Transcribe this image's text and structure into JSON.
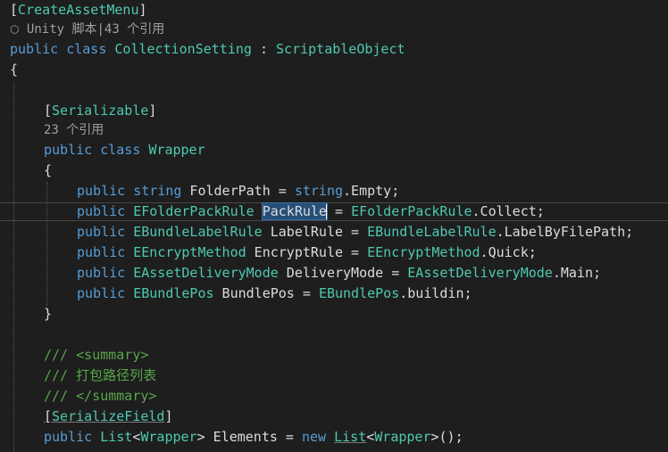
{
  "editor": {
    "lines": {
      "l1": {
        "lb": "[",
        "name": "CreateAssetMenu",
        "rb": "]"
      },
      "l2": {
        "lens": "Unity 脚本|43 个引用"
      },
      "l3": {
        "kw1": "public",
        "kw2": "class",
        "name": "CollectionSetting",
        "colon": " : ",
        "base": "ScriptableObject"
      },
      "l4": {
        "brace": "{"
      },
      "l6": {
        "lb": "[",
        "name": "Serializable",
        "rb": "]"
      },
      "l7": {
        "lens": "23 个引用"
      },
      "l8": {
        "kw1": "public",
        "kw2": "class",
        "name": "Wrapper"
      },
      "l9": {
        "brace": "{"
      },
      "l10": {
        "kw": "public",
        "type": "string",
        "name": " FolderPath",
        "eq": " = ",
        "rtype": "string",
        "rest": ".Empty;"
      },
      "l11": {
        "kw": "public",
        "type": "EFolderPackRule",
        "name": "PackRule",
        "eq": " = ",
        "rtype": "EFolderPackRule",
        "rest": ".Collect;"
      },
      "l12": {
        "kw": "public",
        "type": "EBundleLabelRule",
        "name": " LabelRule",
        "eq": " = ",
        "rtype": "EBundleLabelRule",
        "rest": ".LabelByFilePath;"
      },
      "l13": {
        "kw": "public",
        "type": "EEncryptMethod",
        "name": " EncryptRule",
        "eq": " = ",
        "rtype": "EEncryptMethod",
        "rest": ".Quick;"
      },
      "l14": {
        "kw": "public",
        "type": "EAssetDeliveryMode",
        "name": " DeliveryMode",
        "eq": " = ",
        "rtype": "EAssetDeliveryMode",
        "rest": ".Main;"
      },
      "l15": {
        "kw": "public",
        "type": "EBundlePos",
        "name": " BundlePos",
        "eq": " = ",
        "rtype": "EBundlePos",
        "rest": ".buildin;"
      },
      "l16": {
        "brace": "}"
      },
      "l18": {
        "slashes": "/// ",
        "tag": "<summary>"
      },
      "l19": {
        "slashes": "/// ",
        "text": "打包路径列表"
      },
      "l20": {
        "slashes": "/// ",
        "tag": "</summary>"
      },
      "l21": {
        "lb": "[",
        "name": "SerializeField",
        "rb": "]"
      },
      "l22": {
        "kw": "public",
        "type": "List",
        "lt": "<",
        "targ": "Wrapper",
        "gt": ">",
        "name": " Elements",
        "eq": " = ",
        "newkw": "new",
        "rtype": "List",
        "lt2": "<",
        "targ2": "Wrapper",
        "gt2": ">",
        "rest": "();"
      }
    }
  }
}
